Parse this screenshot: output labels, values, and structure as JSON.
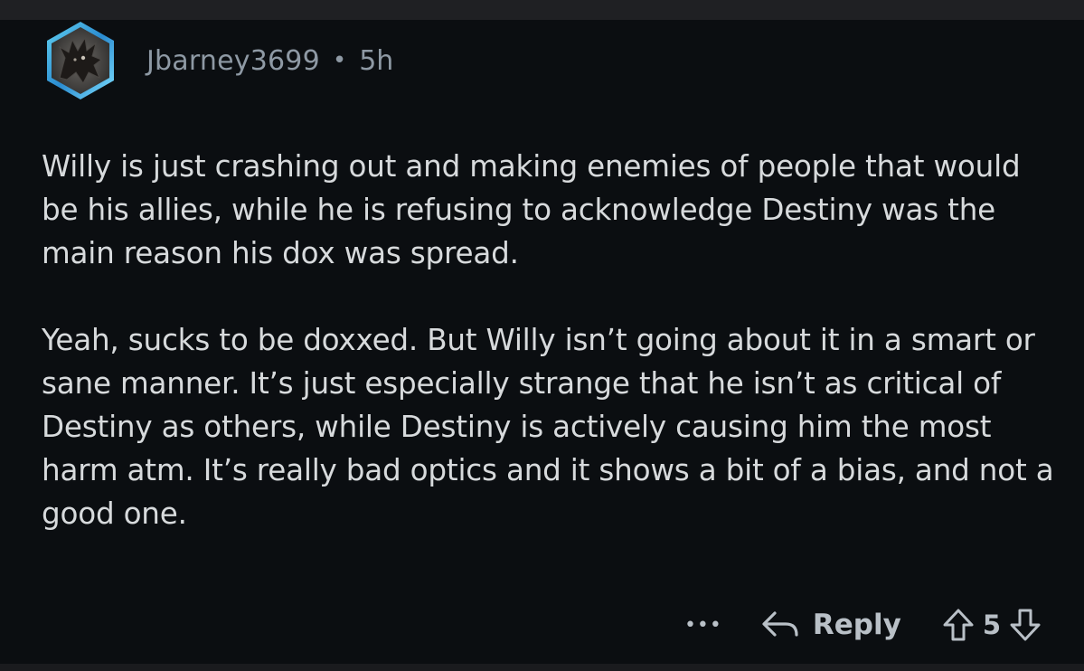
{
  "comment": {
    "author": "Jbarney3699",
    "separator": "•",
    "age": "5h",
    "paragraphs": [
      "Willy is just crashing out and making enemies of people that would be his allies, while he is refusing to acknowledge Destiny was the main reason his dox was spread.",
      "Yeah, sucks to be doxxed. But Willy isn’t going about it in a smart or sane manner. It’s just especially strange that he isn’t as critical of Destiny as others, while Destiny is actively causing him the most harm atm. It’s really bad optics and it shows a bit of a bias, and not a good one."
    ],
    "score": "5"
  },
  "actions": {
    "more_label": "•••",
    "reply_label": "Reply"
  },
  "icons": {
    "more": "more-options-icon",
    "reply": "reply-arrow-icon",
    "upvote": "upvote-arrow-icon",
    "downvote": "downvote-arrow-icon"
  },
  "colors": {
    "background": "#0b0e11",
    "text": "#d7dadc",
    "meta": "#8e99a4",
    "action": "#b9c0c7",
    "avatar_ring": "#3aa7d8"
  }
}
